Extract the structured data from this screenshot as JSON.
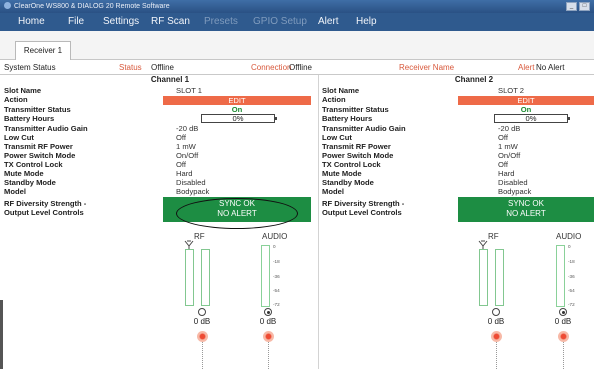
{
  "window": {
    "title": "ClearOne WS800 & DIALOG 20 Remote Software",
    "buttons": [
      "_",
      "□"
    ]
  },
  "menu": [
    "Home",
    "File",
    "Settings",
    "RF Scan",
    "Presets",
    "GPIO Setup",
    "Alert",
    "Help"
  ],
  "tabs": [
    "Receiver 1"
  ],
  "status": {
    "system_label": "System Status",
    "status_label": "Status",
    "status_value": "Offline",
    "connection_label": "Connection",
    "connection_value": "Offline",
    "receiver_label": "Receiver Name",
    "alert_label": "Alert",
    "alert_value": "No Alert"
  },
  "labels": {
    "slot_name": "Slot Name",
    "action": "Action",
    "tx_status": "Transmitter Status",
    "battery": "Battery Hours",
    "gain": "Transmitter Audio Gain",
    "low_cut": "Low Cut",
    "rf_power": "Transmit RF Power",
    "power_switch": "Power Switch Mode",
    "tx_lock": "TX Control Lock",
    "mute_mode": "Mute Mode",
    "standby_mode": "Standby Mode",
    "model": "Model",
    "rf_diversity_1": "RF Diversity Strength -",
    "rf_diversity_2": "Output Level Controls"
  },
  "channels": [
    {
      "title": "Channel 1",
      "slot_name": "SLOT 1",
      "action": "EDIT",
      "tx_status": "On",
      "battery": "0%",
      "battery_level": 0,
      "gain": "-20 dB",
      "low_cut": "Off",
      "rf_power": "1 mW",
      "power_switch": "On/Off",
      "tx_lock": "Off",
      "mute_mode": "Hard",
      "standby_mode": "Disabled",
      "model": "Bodypack",
      "sync_line1": "SYNC OK",
      "sync_line2": "NO ALERT",
      "rf_label": "RF",
      "audio_label": "AUDIO",
      "rf_db": "0 dB",
      "audio_db": "0 dB",
      "ticks": [
        "0",
        "-18",
        "-36",
        "-54",
        "-72"
      ]
    },
    {
      "title": "Channel 2",
      "slot_name": "SLOT 2",
      "action": "EDIT",
      "tx_status": "On",
      "battery": "0%",
      "battery_level": 0,
      "gain": "-20 dB",
      "low_cut": "Off",
      "rf_power": "1 mW",
      "power_switch": "On/Off",
      "tx_lock": "Off",
      "mute_mode": "Hard",
      "standby_mode": "Disabled",
      "model": "Bodypack",
      "sync_line1": "SYNC OK",
      "sync_line2": "NO ALERT",
      "rf_label": "RF",
      "audio_label": "AUDIO",
      "rf_db": "0 dB",
      "audio_db": "0 dB",
      "ticks": [
        "0",
        "-18",
        "-36",
        "-54",
        "-72"
      ]
    }
  ],
  "colors": {
    "menubar": "#2f5a8e",
    "accent_red": "#ee6a48",
    "sync_green": "#1d8d43",
    "status_on": "#1a8a30"
  }
}
